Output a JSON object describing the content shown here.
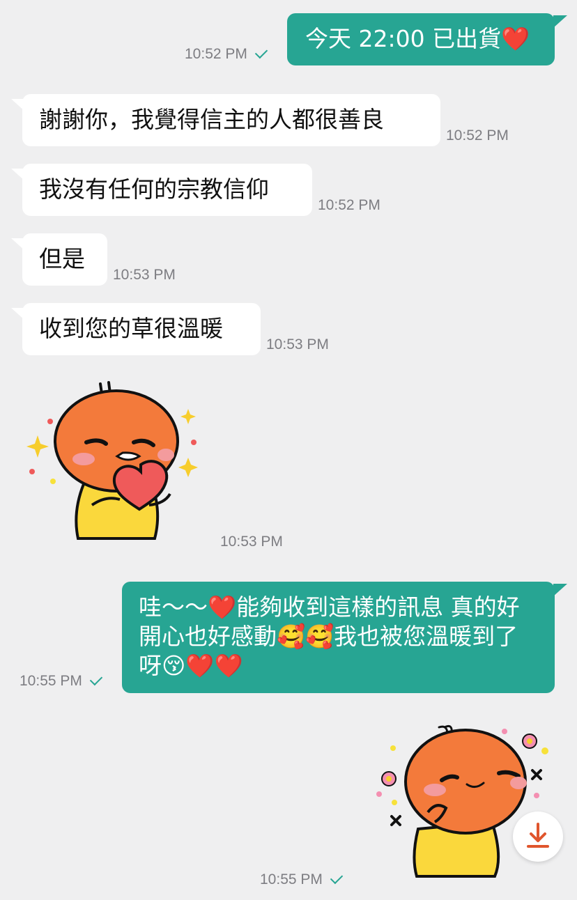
{
  "messages": [
    {
      "text": "今天 22:00 已出貨❤️",
      "time": "10:52 PM"
    },
    {
      "text": "謝謝你，我覺得信主的人都很善良",
      "time": "10:52 PM"
    },
    {
      "text": "我沒有任何的宗教信仰",
      "time": "10:52 PM"
    },
    {
      "text": "但是",
      "time": "10:53 PM"
    },
    {
      "text": "收到您的草很溫暖",
      "time": "10:53 PM"
    },
    {
      "sticker": "heart-hug-sticker",
      "time": "10:53 PM"
    },
    {
      "text": "哇～～❤️能夠收到這樣的訊息 真的好開心也好感動🥰🥰我也被您溫暖到了呀😚❤️❤️",
      "time": "10:55 PM"
    },
    {
      "sticker": "shy-flower-sticker",
      "time": "10:55 PM"
    }
  ],
  "colors": {
    "background": "#efeff0",
    "outgoing_bubble": "#27a593",
    "incoming_bubble": "#ffffff",
    "timestamp": "#7d7d82",
    "download_icon": "#e0552d"
  },
  "download_button": {
    "icon": "download-icon"
  }
}
